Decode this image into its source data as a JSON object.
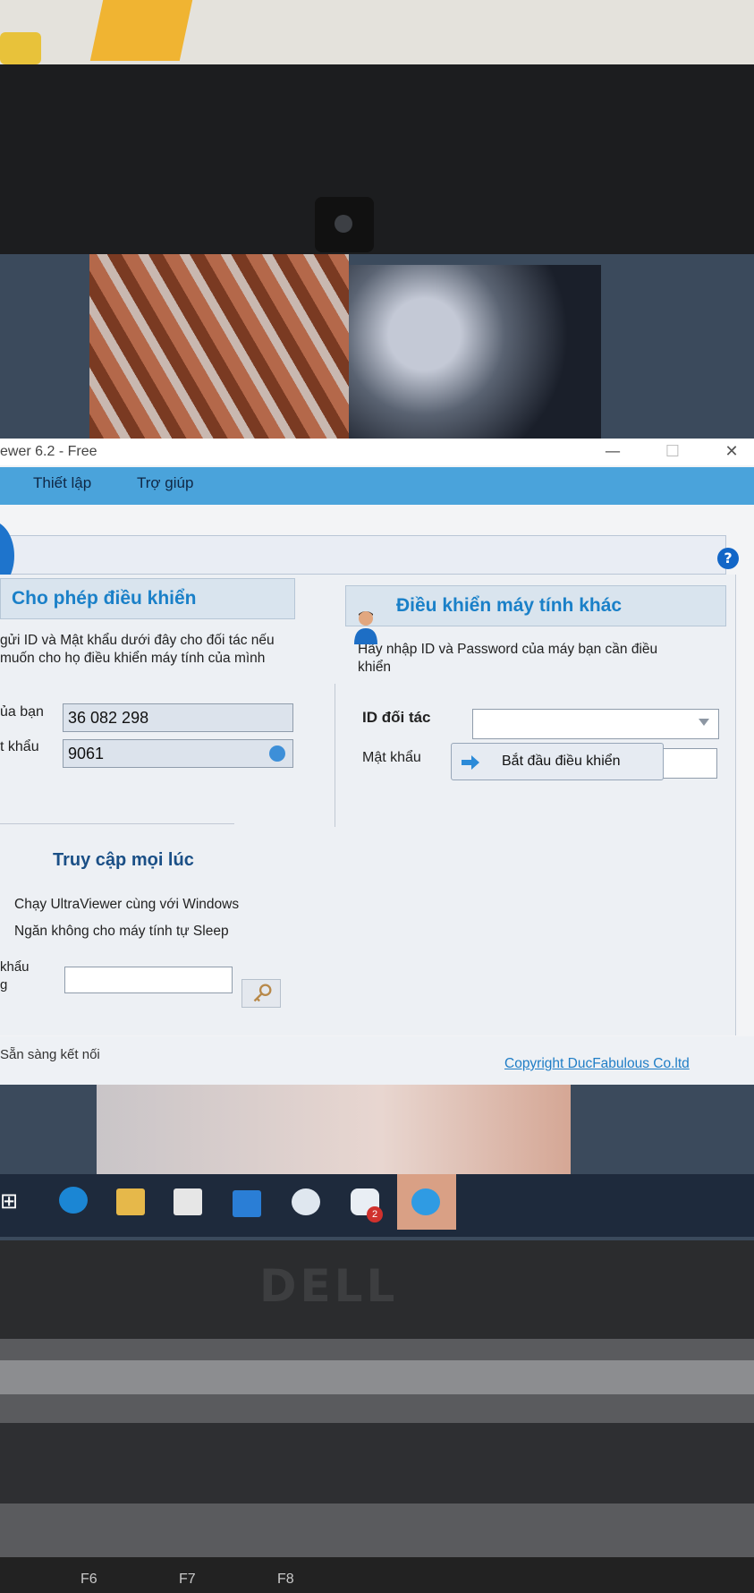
{
  "window": {
    "title": "ewer 6.2 - Free",
    "minimize": "—",
    "maximize": "☐",
    "close": "✕"
  },
  "menu": {
    "items": [
      "Thiết lập",
      "Trợ giúp"
    ]
  },
  "toolbar": {
    "help": "?"
  },
  "allow_control": {
    "title": "Cho phép điều khiển",
    "description_line1": "gửi ID và Mật khẩu dưới đây cho đối tác nếu",
    "description_line2": "muốn cho họ điều khiển máy tính của mình",
    "id_label": "ủa bạn",
    "id_value": "36 082 298",
    "password_label": "t khẩu",
    "password_value": "9061"
  },
  "always_access": {
    "title": "Truy cập mọi lúc",
    "option1": "Chạy UltraViewer cùng với Windows",
    "option2": "Ngăn không cho máy tính tự Sleep",
    "password_label_line1": "khẩu",
    "password_label_line2": "g",
    "password_value": ""
  },
  "control_other": {
    "title": "Điều khiển máy tính khác",
    "description_line1": "Hãy nhập ID và Password của máy bạn cần điều",
    "description_line2": "khiển",
    "partner_id_label": "ID đối tác",
    "partner_id_value": "",
    "password_label": "Mật khẩu",
    "password_value": "",
    "start_button": "Bắt đầu điều khiển"
  },
  "status": {
    "text": "Sẵn sàng kết nối",
    "copyright": "Copyright DucFabulous Co.ltd"
  },
  "taskbar": {
    "badge_count": "2",
    "icons": [
      "task-view-icon",
      "edge-icon",
      "file-explorer-icon",
      "store-icon",
      "mail-icon",
      "chrome-icon",
      "zalo-icon",
      "ultraviewer-icon"
    ]
  },
  "laptop": {
    "brand": "DELL",
    "fkeys": [
      "F6",
      "F7",
      "F8"
    ]
  },
  "colors": {
    "accent": "#4aa3db",
    "title_blue": "#1a80c8",
    "link": "#1f7dc6"
  }
}
